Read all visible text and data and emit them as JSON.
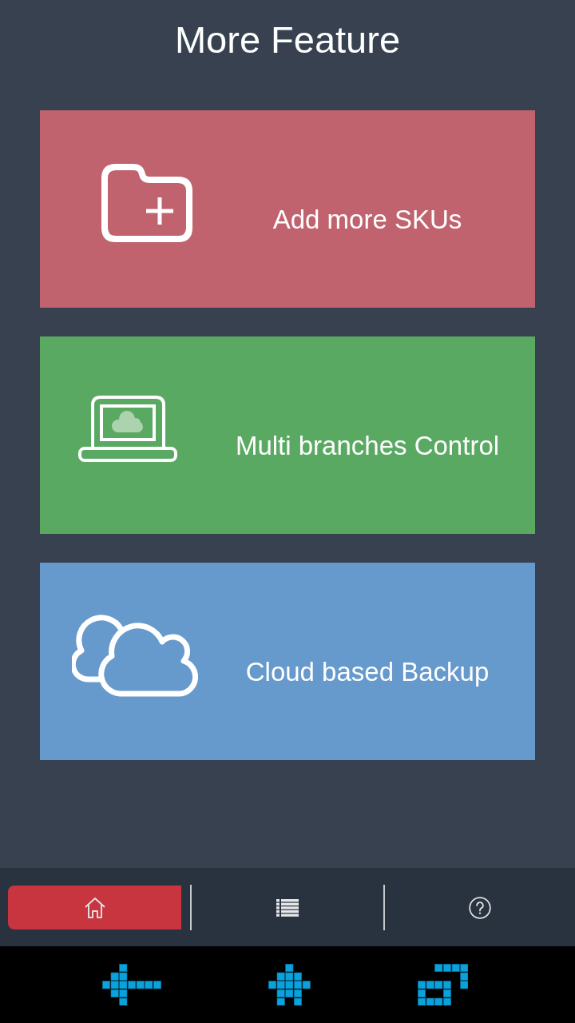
{
  "title": "More Feature",
  "features": [
    {
      "label": "Add more SKUs",
      "color": "#c0636e"
    },
    {
      "label": "Multi branches Control",
      "color": "#5aa963"
    },
    {
      "label": "Cloud based Backup",
      "color": "#6699cc"
    }
  ],
  "tabs": [
    {
      "selected": true
    },
    {
      "selected": false
    },
    {
      "selected": false
    }
  ]
}
